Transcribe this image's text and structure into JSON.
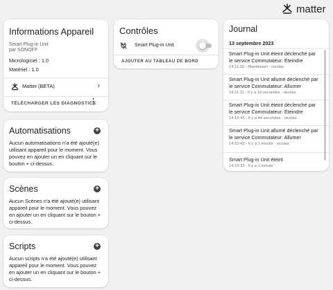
{
  "header": {
    "logo_text": "matter"
  },
  "device_info": {
    "title": "Informations Appareil",
    "device_name": "Smart Plug-in Unit",
    "manufacturer": "par SONOFF",
    "firmware": "Micrologiciel : 1.0",
    "hardware": "Matériel : 1.0",
    "integration": "Matter (BETA)",
    "diagnostics_button": "TÉLÉCHARGER LES DIAGNOSTICS"
  },
  "automations": {
    "title": "Automatisations",
    "text": "Aucun automatisations n'a été ajouté(e) utilisant appareil pour le moment. Vous pouvez en ajouter un en cliquant sur le bouton + ci-dessus."
  },
  "scenes": {
    "title": "Scènes",
    "text": "Aucun Scènes n'a été ajouté(e) utilisant appareil pour le moment. Vous pouvez en ajouter un en cliquant sur le bouton + ci-dessus."
  },
  "scripts": {
    "title": "Scripts",
    "text": "Aucun scripts n'a été ajouté(e) utilisant appareil pour le moment. Vous pouvez en ajouter un en cliquant sur le bouton + ci-dessus."
  },
  "controls": {
    "title": "Contrôles",
    "entity_name": "Smart Plug-in Unit",
    "switch_on": false,
    "add_button": "AJOUTER AU TABLEAU DE BORD"
  },
  "journal": {
    "title": "Journal",
    "date": "13 septembre 2023",
    "entries": [
      {
        "title": "Smart Plug-in Unit éteint déclenché par le service Commutateur: Éteindre",
        "meta": "14:11:30 - Maintenant · nicolas"
      },
      {
        "title": "Smart Plug-in Unit allumé déclenché par le service Commutateur: Allumer",
        "meta": "14:11:11 - Il y a 19 secondes · nicolas"
      },
      {
        "title": "Smart Plug-in Unit éteint déclenché par le service Commutateur: Éteindre",
        "meta": "14:10:46 - Il y a 44 secondes · nicolas"
      },
      {
        "title": "Smart Plug-in Unit allumé déclenché par le service Commutateur: Allumer",
        "meta": "14:10:43 - Il y a 1 minute · nicolas"
      },
      {
        "title": "Smart Plug-in Unit éteint",
        "meta": "14:10:33 - Il y a 1 minute"
      }
    ]
  },
  "colors": {
    "background": "#f1f1f1",
    "card": "#ffffff",
    "icon": "#424242",
    "switch_off": "#bdbdbd"
  }
}
